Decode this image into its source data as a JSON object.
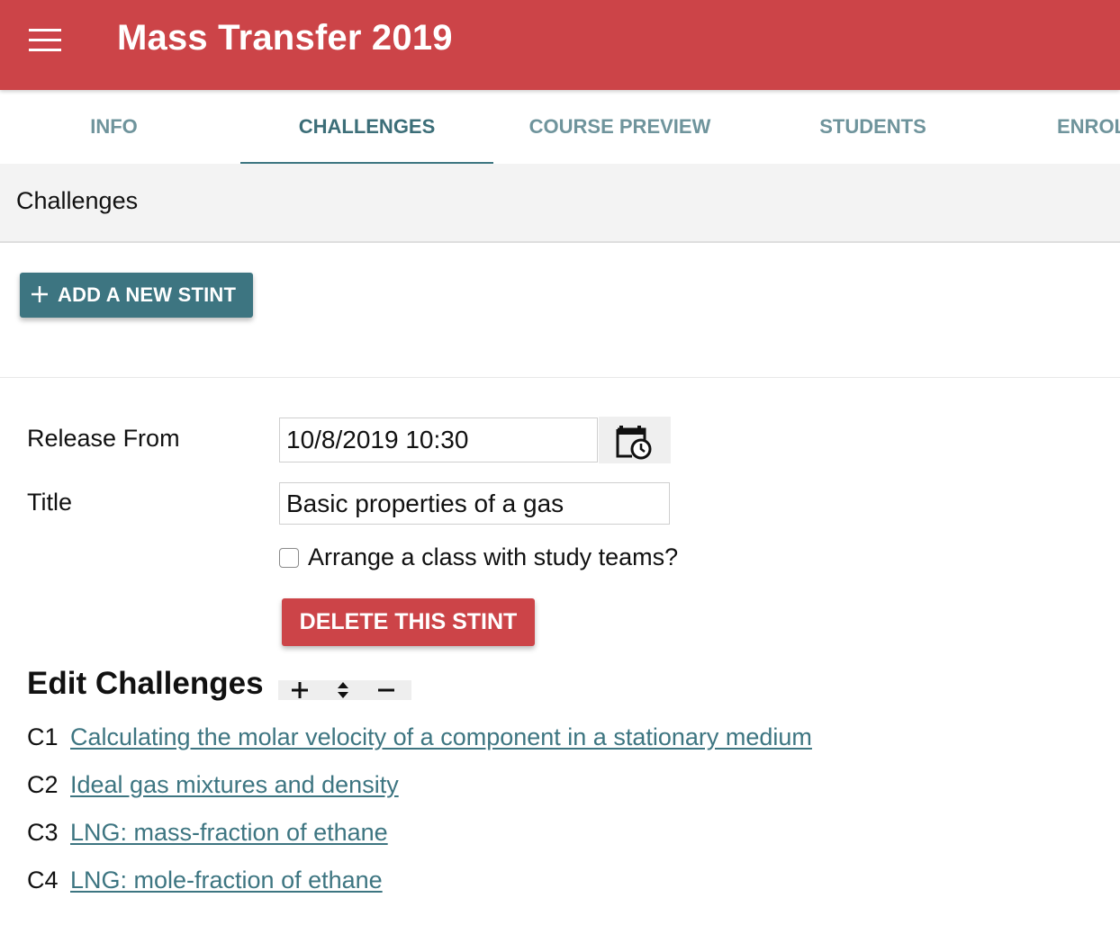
{
  "header": {
    "title": "Mass Transfer 2019"
  },
  "tabs": [
    {
      "label": "INFO"
    },
    {
      "label": "CHALLENGES"
    },
    {
      "label": "COURSE PREVIEW"
    },
    {
      "label": "STUDENTS"
    },
    {
      "label": "ENROL"
    }
  ],
  "section": {
    "title": "Challenges"
  },
  "add_stint": {
    "label": "ADD A NEW STINT"
  },
  "form": {
    "release_label": "Release From",
    "release_value": "10/8/2019 10:30",
    "title_label": "Title",
    "title_value": "Basic properties of a gas",
    "study_teams_label": "Arrange a class with study teams?",
    "study_teams_checked": false,
    "delete_label": "DELETE THIS STINT"
  },
  "edit": {
    "heading": "Edit Challenges"
  },
  "challenges": [
    {
      "code": "C1",
      "title": "Calculating the molar velocity of a component in a stationary medium"
    },
    {
      "code": "C2",
      "title": "Ideal gas mixtures and density"
    },
    {
      "code": "C3",
      "title": "LNG: mass-fraction of ethane"
    },
    {
      "code": "C4",
      "title": "LNG: mole-fraction of ethane"
    }
  ],
  "colors": {
    "brand_red": "#cc4448",
    "teal": "#3d7581"
  }
}
